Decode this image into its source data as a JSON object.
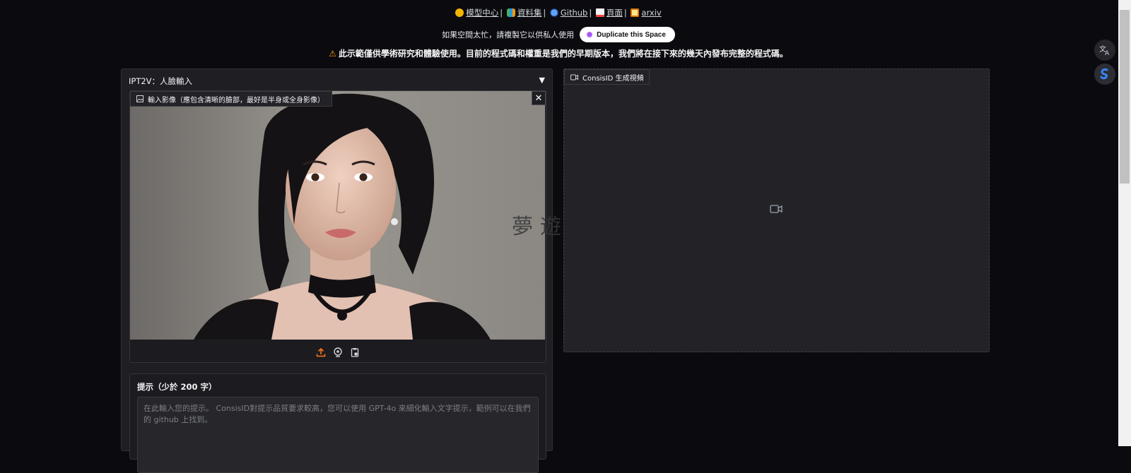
{
  "header": {
    "links": [
      {
        "label": "模型中心",
        "icon": "hugging-face-icon"
      },
      {
        "label": "資料集",
        "icon": "books-icon"
      },
      {
        "label": "Github",
        "icon": "globe-icon"
      },
      {
        "label": "頁面",
        "icon": "page-icon"
      },
      {
        "label": "arxiv",
        "icon": "scroll-icon"
      }
    ],
    "separator": "|",
    "busy_text": "如果空間太忙，請複製它以供私人使用",
    "duplicate_label": "Duplicate this Space",
    "warning_icon": "⚠",
    "warning_text": "此示範僅供學術研究和體驗使用。目前的程式碼和權重是我們的早期版本，我們將在接下來的幾天內發布完整的程式碼。"
  },
  "left_panel": {
    "title": "IPT2V：人臉輸入",
    "collapse_symbol": "▼",
    "image_label": "輸入影像（應包含清晰的臉部，最好是半身或全身影像）",
    "close_symbol": "✕",
    "tools": [
      "upload-icon",
      "webcam-icon",
      "clipboard-icon"
    ],
    "prompt_label": "提示（少於 200 字）",
    "prompt_placeholder": "在此輸入您的提示。 ConsisID對提示品質要求較高，您可以使用 GPT-4o 來細化輸入文字提示，範例可以在我們的 github 上找到。"
  },
  "right_panel": {
    "video_label": "ConsisID 生成視頻"
  },
  "watermark": "夢遊電玩",
  "colors": {
    "background": "#0b0b0f",
    "panel": "#1f1f23",
    "accent_orange": "#f97316",
    "duplicate_dot": "#a855f7"
  }
}
